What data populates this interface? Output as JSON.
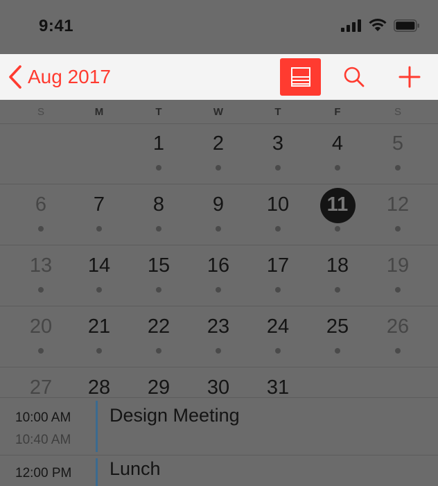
{
  "status": {
    "time": "9:41"
  },
  "nav": {
    "back_label": "Aug 2017",
    "accent": "#ff3b30"
  },
  "weekdays": [
    "S",
    "M",
    "T",
    "W",
    "T",
    "F",
    "S"
  ],
  "weeks": [
    [
      "",
      "",
      "1",
      "2",
      "3",
      "4",
      "5"
    ],
    [
      "6",
      "7",
      "8",
      "9",
      "10",
      "11",
      "12"
    ],
    [
      "13",
      "14",
      "15",
      "16",
      "17",
      "18",
      "19"
    ],
    [
      "20",
      "21",
      "22",
      "23",
      "24",
      "25",
      "26"
    ],
    [
      "27",
      "28",
      "29",
      "30",
      "31",
      "",
      ""
    ]
  ],
  "today": "11",
  "events": [
    {
      "start": "10:00 AM",
      "end": "10:40 AM",
      "title": "Design Meeting"
    },
    {
      "start": "12:00 PM",
      "end": "",
      "title": "Lunch"
    }
  ]
}
